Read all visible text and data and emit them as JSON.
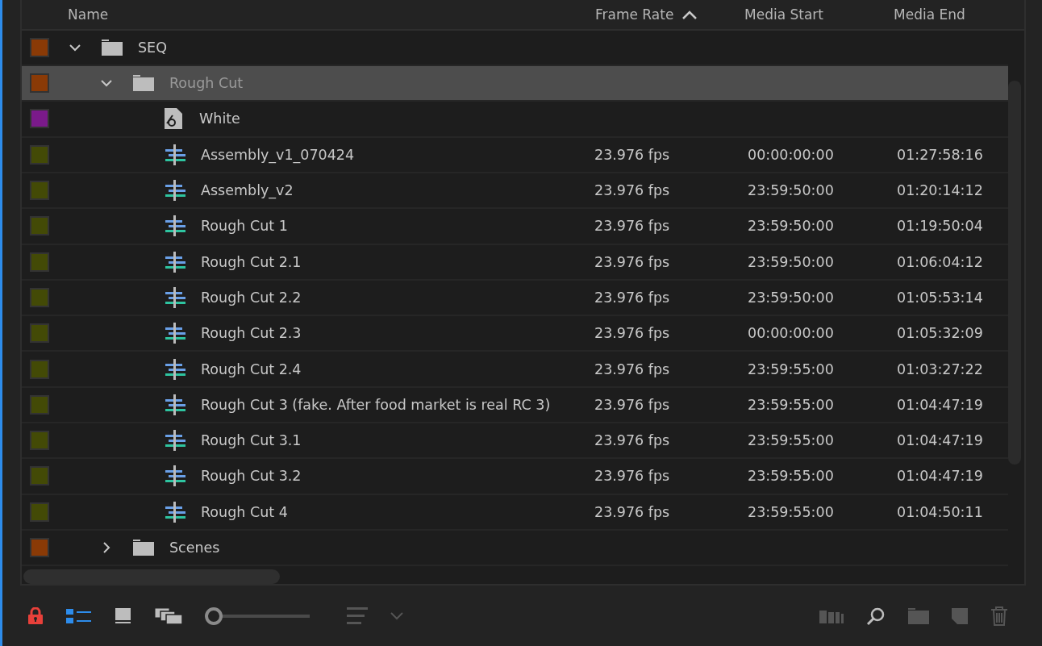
{
  "columns": [
    {
      "label": "Name",
      "sorted": false
    },
    {
      "label": "Frame Rate",
      "sorted": true
    },
    {
      "label": "Media Start",
      "sorted": false
    },
    {
      "label": "Media End",
      "sorted": false
    }
  ],
  "items": [
    {
      "kind": "folder",
      "name": "SEQ",
      "color": "#8a3a06",
      "expanded": true,
      "selected": false,
      "children": [
        {
          "kind": "folder",
          "name": "Rough Cut",
          "color": "#8a3a06",
          "expanded": true,
          "selected": true,
          "children": [
            {
              "kind": "graphic",
              "name": "White",
              "color": "#7a1a8a",
              "selected": false
            },
            {
              "kind": "sequence",
              "name": "Assembly_v1_070424",
              "color": "#434a06",
              "selected": false,
              "frame_rate": "23.976 fps",
              "media_start": "00:00:00:00",
              "media_end": "01:27:58:16"
            },
            {
              "kind": "sequence",
              "name": "Assembly_v2",
              "color": "#434a06",
              "selected": false,
              "frame_rate": "23.976 fps",
              "media_start": "23:59:50:00",
              "media_end": "01:20:14:12"
            },
            {
              "kind": "sequence",
              "name": "Rough Cut 1",
              "color": "#434a06",
              "selected": false,
              "frame_rate": "23.976 fps",
              "media_start": "23:59:50:00",
              "media_end": "01:19:50:04"
            },
            {
              "kind": "sequence",
              "name": "Rough Cut 2.1",
              "color": "#434a06",
              "selected": false,
              "frame_rate": "23.976 fps",
              "media_start": "23:59:50:00",
              "media_end": "01:06:04:12"
            },
            {
              "kind": "sequence",
              "name": "Rough Cut 2.2",
              "color": "#434a06",
              "selected": false,
              "frame_rate": "23.976 fps",
              "media_start": "23:59:50:00",
              "media_end": "01:05:53:14"
            },
            {
              "kind": "sequence",
              "name": "Rough Cut 2.3",
              "color": "#434a06",
              "selected": false,
              "frame_rate": "23.976 fps",
              "media_start": "00:00:00:00",
              "media_end": "01:05:32:09"
            },
            {
              "kind": "sequence",
              "name": "Rough Cut 2.4",
              "color": "#434a06",
              "selected": false,
              "frame_rate": "23.976 fps",
              "media_start": "23:59:55:00",
              "media_end": "01:03:27:22"
            },
            {
              "kind": "sequence",
              "name": "Rough Cut 3 (fake. After food market is real RC 3)",
              "color": "#434a06",
              "selected": false,
              "frame_rate": "23.976 fps",
              "media_start": "23:59:55:00",
              "media_end": "01:04:47:19"
            },
            {
              "kind": "sequence",
              "name": "Rough Cut 3.1",
              "color": "#434a06",
              "selected": false,
              "frame_rate": "23.976 fps",
              "media_start": "23:59:55:00",
              "media_end": "01:04:47:19"
            },
            {
              "kind": "sequence",
              "name": "Rough Cut 3.2",
              "color": "#434a06",
              "selected": false,
              "frame_rate": "23.976 fps",
              "media_start": "23:59:55:00",
              "media_end": "01:04:47:19"
            },
            {
              "kind": "sequence",
              "name": "Rough Cut 4",
              "color": "#434a06",
              "selected": false,
              "frame_rate": "23.976 fps",
              "media_start": "23:59:55:00",
              "media_end": "01:04:50:11"
            }
          ]
        },
        {
          "kind": "folder",
          "name": "Scenes",
          "color": "#8a3a06",
          "expanded": false,
          "selected": false
        }
      ]
    }
  ],
  "toolbar": {
    "views": [
      {
        "kind": "list",
        "selected": true
      },
      {
        "kind": "icon",
        "selected": false
      },
      {
        "kind": "freeform",
        "selected": false
      }
    ],
    "zoom": {
      "level": 0.0
    }
  }
}
